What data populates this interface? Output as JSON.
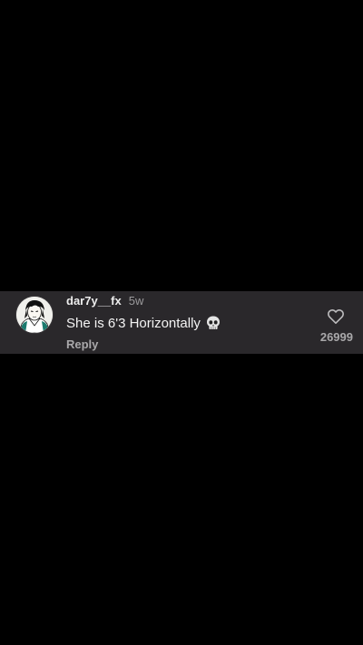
{
  "comment": {
    "username": "dar7y__fx",
    "age": "5w",
    "text": "She is 6'3 Horizontally",
    "emoji_icon": "skull-icon",
    "reply_label": "Reply",
    "like_icon": "heart-outline-icon",
    "like_count": "26999"
  },
  "colors": {
    "page_background": "#000000",
    "card_background": "#2a282b",
    "primary_text": "#f4f4f4",
    "secondary_text": "#a9a8aa"
  }
}
